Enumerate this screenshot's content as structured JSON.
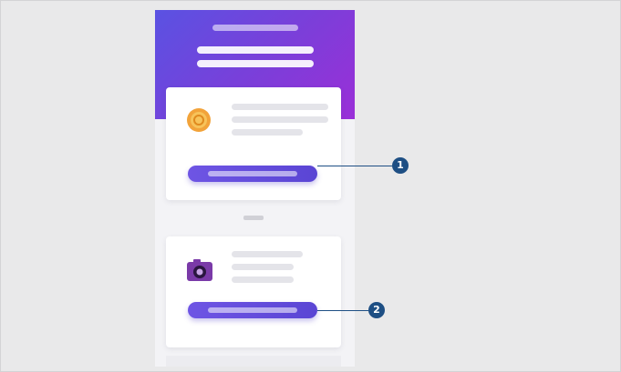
{
  "callouts": [
    {
      "number": "1"
    },
    {
      "number": "2"
    }
  ],
  "icons": {
    "card_1": "coin-icon",
    "card_2": "camera-icon"
  },
  "colors": {
    "background": "#e9e9ea",
    "header_gradient_start": "#5a52e2",
    "header_gradient_end": "#9a2fd8",
    "button": "#6152db",
    "callout": "#1e4f84",
    "coin": "#f2a33a",
    "camera": "#7a3aa8"
  }
}
